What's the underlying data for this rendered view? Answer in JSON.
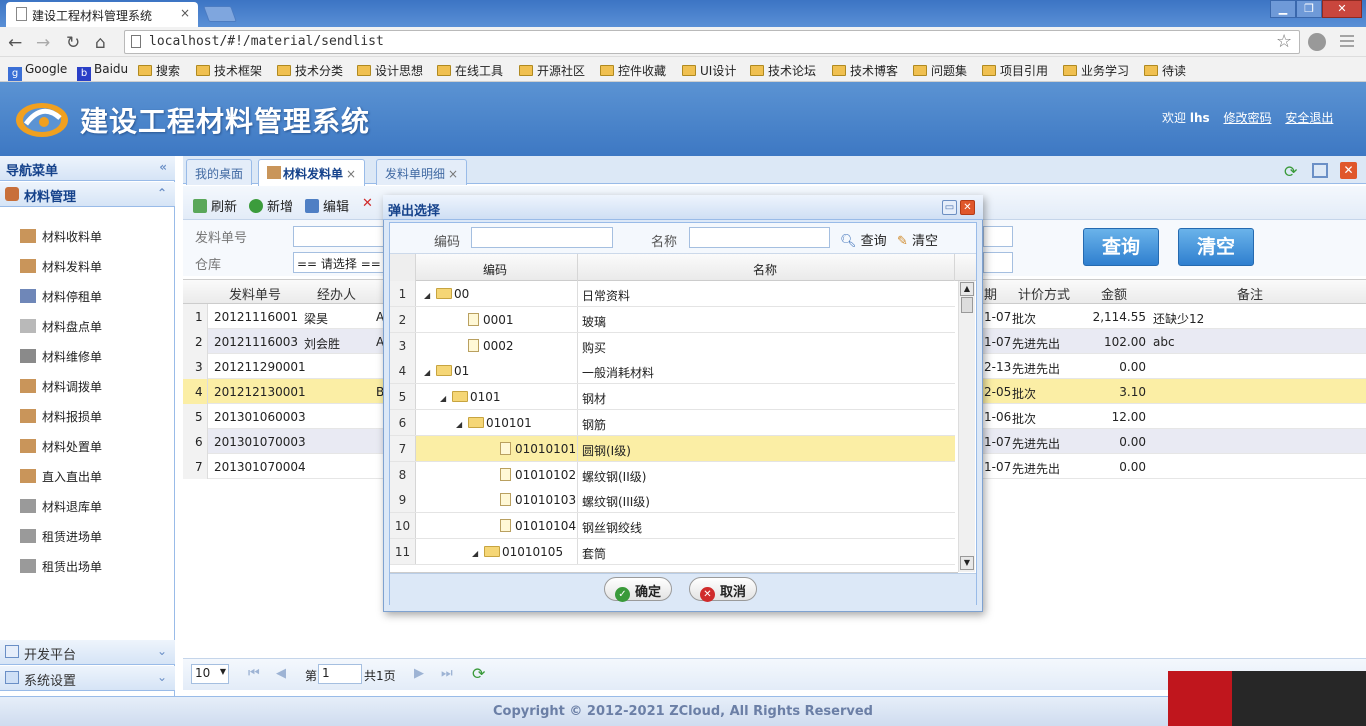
{
  "browser": {
    "tab_title": "建设工程材料管理系统",
    "tab_close": "×",
    "url": "localhost/#!/material/sendlist",
    "bookmarks": [
      "Google",
      "Baidu",
      "搜索",
      "技术框架",
      "技术分类",
      "设计思想",
      "在线工具",
      "开源社区",
      "控件收藏",
      "UI设计",
      "技术论坛",
      "技术博客",
      "问题集",
      "项目引用",
      "业务学习",
      "待读"
    ]
  },
  "app": {
    "title": "建设工程材料管理系统",
    "welcome_prefix": "欢迎",
    "user": "lhs",
    "change_password": "修改密码",
    "logout": "安全退出"
  },
  "nav": {
    "header": "导航菜单",
    "section": "材料管理",
    "items": [
      "材料收料单",
      "材料发料单",
      "材料停租单",
      "材料盘点单",
      "材料维修单",
      "材料调拨单",
      "材料报损单",
      "材料处置单",
      "直入直出单",
      "材料退库单",
      "租赁进场单",
      "租赁出场单"
    ],
    "bottom_sections": [
      "开发平台",
      "系统设置"
    ]
  },
  "tabs": [
    {
      "label": "我的桌面"
    },
    {
      "label": "材料发料单",
      "close": "×"
    },
    {
      "label": "发料单明细",
      "close": "×"
    }
  ],
  "toolbar": {
    "refresh": "刷新",
    "add": "新增",
    "edit": "编辑"
  },
  "filter": {
    "order_label": "发料单号",
    "warehouse_label": "仓库",
    "warehouse_value": "== 请选择 ==",
    "query": "查询",
    "clear": "清空"
  },
  "grid": {
    "columns": [
      "发料单号",
      "经办人",
      "期",
      "计价方式",
      "金额",
      "备注"
    ],
    "rows": [
      {
        "n": "1",
        "no": "20121116001",
        "agent": "梁昊",
        "a": "A",
        "date": "1-07",
        "method": "批次",
        "amount": "2,114.55",
        "remark": "还缺少12"
      },
      {
        "n": "2",
        "no": "20121116003",
        "agent": "刘会胜",
        "a": "A",
        "date": "1-07",
        "method": "先进先出",
        "amount": "102.00",
        "remark": "abc"
      },
      {
        "n": "3",
        "no": "201211290001",
        "agent": "",
        "a": "",
        "date": "2-13",
        "method": "先进先出",
        "amount": "0.00",
        "remark": ""
      },
      {
        "n": "4",
        "no": "201212130001",
        "agent": "",
        "a": "B",
        "date": "2-05",
        "method": "批次",
        "amount": "3.10",
        "remark": ""
      },
      {
        "n": "5",
        "no": "201301060003",
        "agent": "",
        "a": "",
        "date": "1-06",
        "method": "批次",
        "amount": "12.00",
        "remark": ""
      },
      {
        "n": "6",
        "no": "201301070003",
        "agent": "",
        "a": "",
        "date": "1-07",
        "method": "先进先出",
        "amount": "0.00",
        "remark": ""
      },
      {
        "n": "7",
        "no": "201301070004",
        "agent": "",
        "a": "",
        "date": "1-07",
        "method": "先进先出",
        "amount": "0.00",
        "remark": ""
      }
    ]
  },
  "pager": {
    "page_size": "10",
    "page_prefix": "第",
    "page_value": "1",
    "total": "共1页"
  },
  "dialog": {
    "title": "弹出选择",
    "code_label": "编码",
    "name_label": "名称",
    "query": "查询",
    "clear": "清空",
    "col_code": "编码",
    "col_name": "名称",
    "rows": [
      {
        "n": "1",
        "code": "00",
        "name": "日常资料",
        "lvl": 0,
        "type": "folder"
      },
      {
        "n": "2",
        "code": "0001",
        "name": "玻璃",
        "lvl": 1,
        "type": "file"
      },
      {
        "n": "3",
        "code": "0002",
        "name": "购买",
        "lvl": 1,
        "type": "file"
      },
      {
        "n": "4",
        "code": "01",
        "name": "一般消耗材料",
        "lvl": 0,
        "type": "folder"
      },
      {
        "n": "5",
        "code": "0101",
        "name": "钢材",
        "lvl": 1,
        "type": "folder"
      },
      {
        "n": "6",
        "code": "010101",
        "name": "钢筋",
        "lvl": 2,
        "type": "folder"
      },
      {
        "n": "7",
        "code": "01010101",
        "name": "圆钢(I级)",
        "lvl": 3,
        "type": "file"
      },
      {
        "n": "8",
        "code": "01010102",
        "name": "螺纹钢(II级)",
        "lvl": 3,
        "type": "file"
      },
      {
        "n": "9",
        "code": "01010103",
        "name": "螺纹钢(III级)",
        "lvl": 3,
        "type": "file"
      },
      {
        "n": "10",
        "code": "01010104",
        "name": "钢丝钢绞线",
        "lvl": 3,
        "type": "file"
      },
      {
        "n": "11",
        "code": "01010105",
        "name": "套筒",
        "lvl": 3,
        "type": "folder"
      }
    ],
    "ok": "确定",
    "cancel": "取消"
  },
  "footer": "Copyright © 2012-2021 ZCloud, All Rights Reserved"
}
